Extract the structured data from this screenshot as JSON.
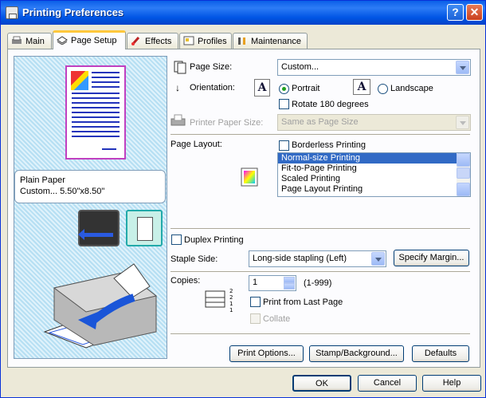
{
  "window": {
    "title": "Printing Preferences",
    "help_btn": "?",
    "close_btn": "✕"
  },
  "tabs": [
    {
      "label": "Main"
    },
    {
      "label": "Page Setup"
    },
    {
      "label": "Effects"
    },
    {
      "label": "Profiles"
    },
    {
      "label": "Maintenance"
    }
  ],
  "preview": {
    "media_type": "Plain Paper",
    "paper_size": "Custom... 5.50\"x8.50\""
  },
  "page_size": {
    "label": "Page Size:",
    "value": "Custom..."
  },
  "orientation": {
    "label": "Orientation:",
    "portrait": "Portrait",
    "landscape": "Landscape",
    "glyph": "A"
  },
  "rotate": {
    "label": "Rotate 180 degrees"
  },
  "printer_paper_size": {
    "label": "Printer Paper Size:",
    "value": "Same as Page Size"
  },
  "page_layout": {
    "label": "Page Layout:",
    "borderless": "Borderless Printing",
    "options": [
      "Normal-size Printing",
      "Fit-to-Page Printing",
      "Scaled Printing",
      "Page Layout Printing"
    ]
  },
  "duplex": {
    "label": "Duplex Printing"
  },
  "staple": {
    "label": "Staple Side:",
    "value": "Long-side stapling (Left)",
    "specify_margin": "Specify Margin..."
  },
  "copies": {
    "label": "Copies:",
    "value": "1",
    "range": "(1-999)",
    "print_last": "Print from Last Page",
    "collate": "Collate"
  },
  "panel_buttons": {
    "print_options": "Print Options...",
    "stamp": "Stamp/Background...",
    "defaults": "Defaults"
  },
  "dialog_buttons": {
    "ok": "OK",
    "cancel": "Cancel",
    "help": "Help"
  }
}
